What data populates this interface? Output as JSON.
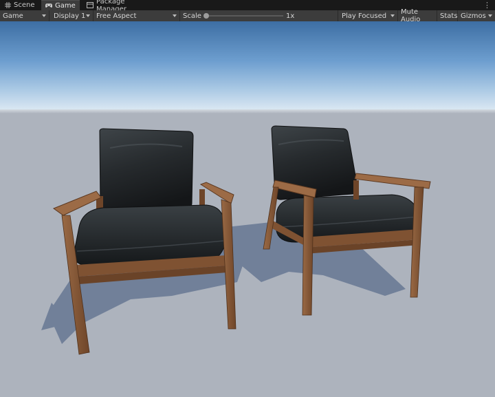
{
  "tabs": [
    {
      "label": "Scene",
      "icon": "hash-icon",
      "active": false
    },
    {
      "label": "Game",
      "icon": "gamepad-icon",
      "active": true
    },
    {
      "label": "Package Manager",
      "icon": "package-icon",
      "active": false
    }
  ],
  "toolbar": {
    "view_mode": "Game",
    "display": "Display 1",
    "aspect": "Free Aspect",
    "scale_label": "Scale",
    "scale_value": "1x",
    "play_mode": "Play Focused",
    "mute_audio": "Mute Audio",
    "stats": "Stats",
    "gizmos": "Gizmos"
  },
  "colors": {
    "tab_bar": "#191919",
    "toolbar": "#3c3c3c",
    "sky_top": "#3d6ea3",
    "horizon": "#d9e7f2",
    "ground": "#adb3bd",
    "leather": "#2b2f32",
    "wood": "#8a5a3a"
  }
}
